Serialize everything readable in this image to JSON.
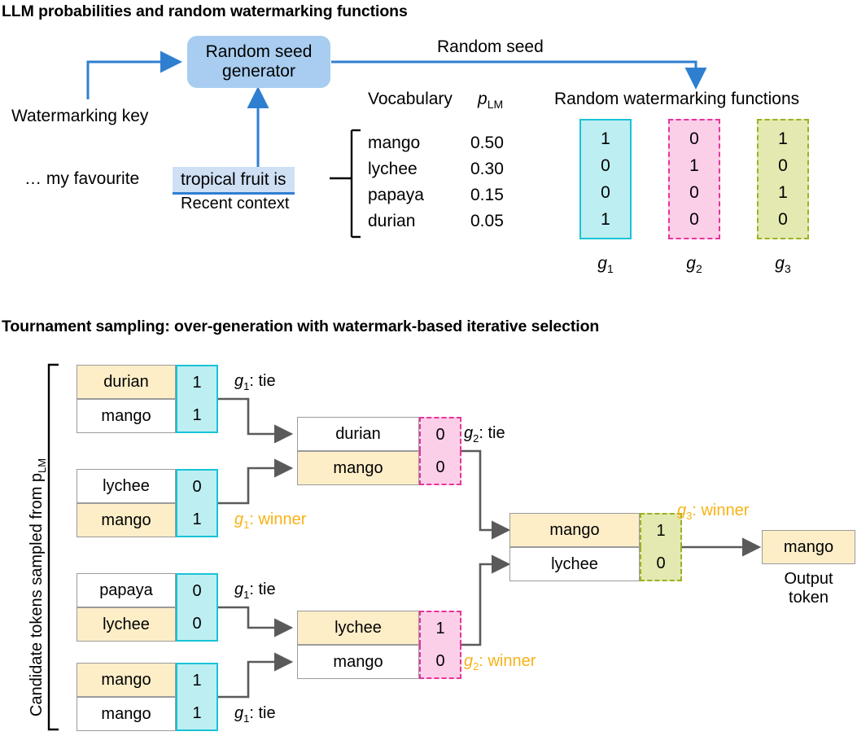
{
  "top": {
    "heading": "LLM probabilities and random watermarking functions",
    "seed_generator": {
      "line1": "Random seed",
      "line2": "generator"
    },
    "watermarking_key_label": "Watermarking key",
    "random_seed_label": "Random seed",
    "context_prefix": "… my favourite",
    "context_box": "tropical fruit is",
    "context_caption": "Recent context",
    "vocab_header": "Vocabulary",
    "plm_header": "p",
    "plm_sub": "LM",
    "vocabulary": [
      {
        "token": "mango",
        "p": "0.50"
      },
      {
        "token": "lychee",
        "p": "0.30"
      },
      {
        "token": "papaya",
        "p": "0.15"
      },
      {
        "token": "durian",
        "p": "0.05"
      }
    ],
    "functions_header": "Random watermarking functions",
    "functions": [
      {
        "name": "g",
        "sub": "1",
        "bits": [
          "1",
          "0",
          "0",
          "1"
        ],
        "color": "#18c3d6",
        "fill": "#bdeef2",
        "style": "solid"
      },
      {
        "name": "g",
        "sub": "2",
        "bits": [
          "0",
          "1",
          "0",
          "0"
        ],
        "color": "#e8339c",
        "fill": "#fbcfe8",
        "style": "dashed"
      },
      {
        "name": "g",
        "sub": "3",
        "bits": [
          "1",
          "0",
          "1",
          "0"
        ],
        "color": "#9cb023",
        "fill": "#e3e9b0",
        "style": "dashdot"
      }
    ]
  },
  "bottom": {
    "heading": "Tournament sampling: over-generation with watermark-based iterative selection",
    "side_label": "Candidate tokens sampled from p",
    "side_label_sub": "LM",
    "round1": [
      {
        "rows": [
          {
            "token": "durian",
            "bit": "1",
            "hl": true
          },
          {
            "token": "mango",
            "bit": "1",
            "hl": false
          }
        ],
        "tag": "g",
        "tag_sub": "1",
        "tag_text": ": tie",
        "winner": false
      },
      {
        "rows": [
          {
            "token": "lychee",
            "bit": "0",
            "hl": false
          },
          {
            "token": "mango",
            "bit": "1",
            "hl": true
          }
        ],
        "tag": "g",
        "tag_sub": "1",
        "tag_text": ": winner",
        "winner": true
      },
      {
        "rows": [
          {
            "token": "papaya",
            "bit": "0",
            "hl": false
          },
          {
            "token": "lychee",
            "bit": "0",
            "hl": true
          }
        ],
        "tag": "g",
        "tag_sub": "1",
        "tag_text": ": tie",
        "winner": false
      },
      {
        "rows": [
          {
            "token": "mango",
            "bit": "1",
            "hl": true
          },
          {
            "token": "mango",
            "bit": "1",
            "hl": false
          }
        ],
        "tag": "g",
        "tag_sub": "1",
        "tag_text": ": tie",
        "winner": false
      }
    ],
    "round2": [
      {
        "rows": [
          {
            "token": "durian",
            "bit": "0",
            "hl": false
          },
          {
            "token": "mango",
            "bit": "0",
            "hl": true
          }
        ],
        "tag": "g",
        "tag_sub": "2",
        "tag_text": ": tie",
        "winner": false
      },
      {
        "rows": [
          {
            "token": "lychee",
            "bit": "1",
            "hl": true
          },
          {
            "token": "mango",
            "bit": "0",
            "hl": false
          }
        ],
        "tag": "g",
        "tag_sub": "2",
        "tag_text": ": winner",
        "winner": true
      }
    ],
    "round3": {
      "rows": [
        {
          "token": "mango",
          "bit": "1",
          "hl": true
        },
        {
          "token": "lychee",
          "bit": "0",
          "hl": false
        }
      ],
      "tag": "g",
      "tag_sub": "3",
      "tag_text": ": winner",
      "winner": true
    },
    "output": {
      "token": "mango",
      "caption_line1": "Output",
      "caption_line2": "token"
    }
  },
  "colors": {
    "blue": "#2f7fd1",
    "seed_fill": "#a8cdf0",
    "cream": "#fdeec8",
    "cyan": "#18c3d6",
    "pink": "#e8339c",
    "olive": "#9cb023",
    "amber": "#f7b317",
    "arrow_gray": "#5a5a5a"
  }
}
